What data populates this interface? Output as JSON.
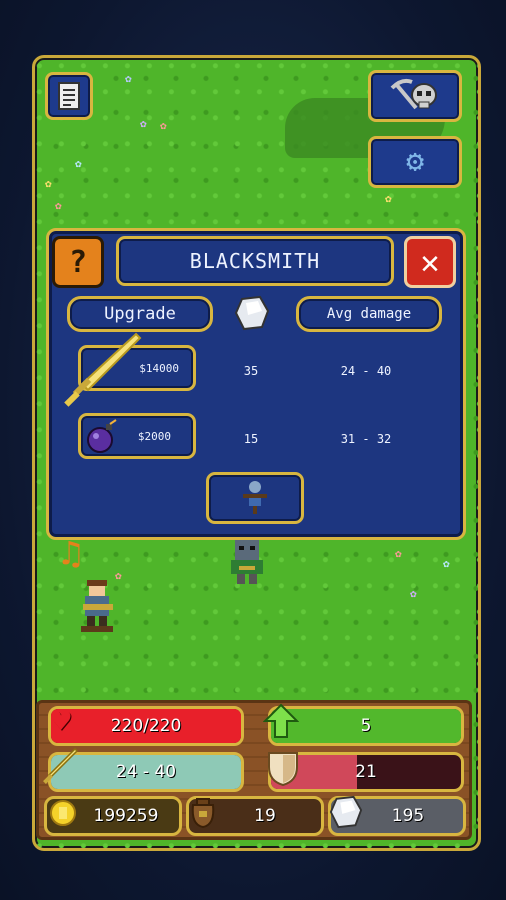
{
  "menu": {
    "notes_icon": "document-icon",
    "skull_icon": "skull-pickaxe-icon",
    "settings_icon": "gear-icon"
  },
  "blacksmith": {
    "title": "BLACKSMITH",
    "help_label": "?",
    "close_label": "✕",
    "col_upgrade": "Upgrade",
    "col_gem_icon": "crystal-icon",
    "col_avg_damage": "Avg damage",
    "rows": [
      {
        "item_icon": "sword-icon",
        "price": "$14000",
        "crystals": "35",
        "damage": "24 - 40"
      },
      {
        "item_icon": "bomb-icon",
        "price": "$2000",
        "crystals": "15",
        "damage": "31 - 32"
      }
    ],
    "bottom_icon": "scarecrow-icon"
  },
  "stats": {
    "health": {
      "value": "220/220",
      "fraction": 1.0,
      "color": "#e8202a"
    },
    "level": {
      "value": "5",
      "fraction": 1.0,
      "color": "#52b82c"
    },
    "damage": {
      "value": "24 - 40",
      "fraction": 1.0,
      "color": "#8ec9b6"
    },
    "armor": {
      "value": "21",
      "fraction": 0.45,
      "color": "#d0485a"
    },
    "gold": {
      "value": "199259"
    },
    "bag": {
      "value": "19"
    },
    "crystals": {
      "value": "195"
    }
  },
  "colors": {
    "panel": "#1d3680",
    "border": "#d8b640",
    "grass": "#4fb52a"
  }
}
